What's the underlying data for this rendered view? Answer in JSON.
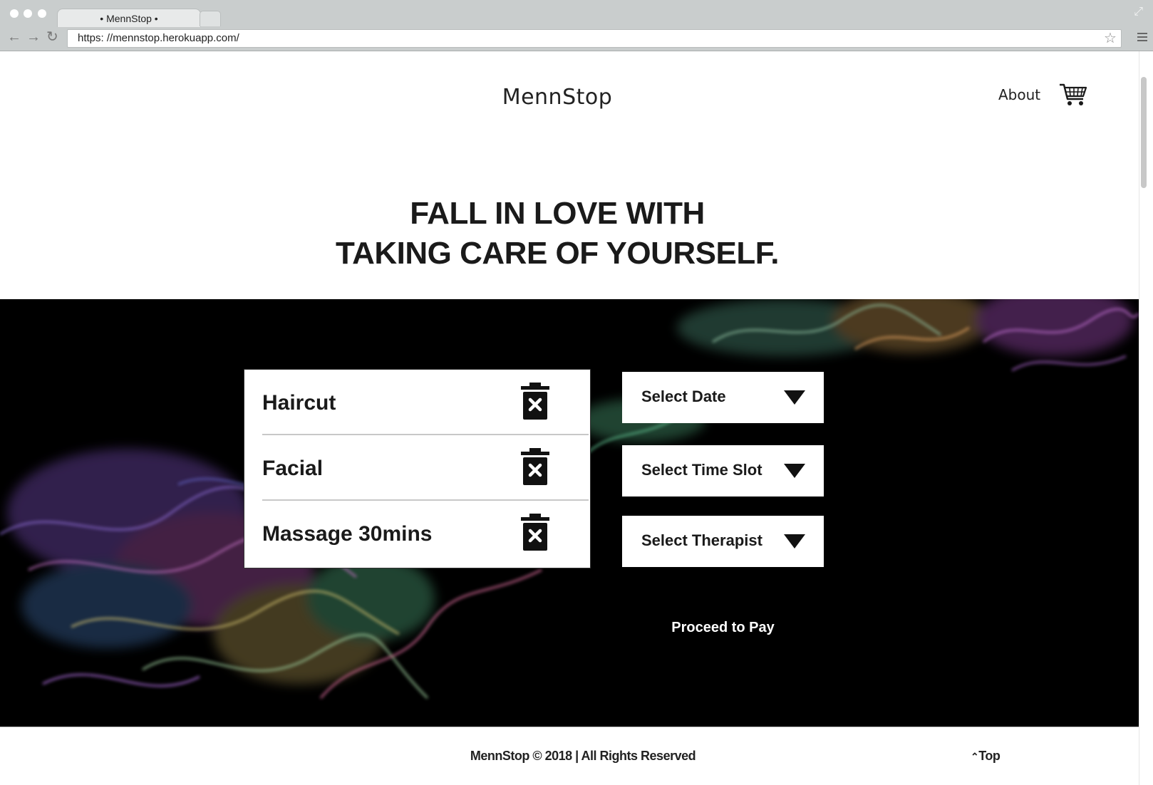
{
  "browser": {
    "tab_title": "• MennStop •",
    "url": "https: //mennstop.herokuapp.com/"
  },
  "header": {
    "brand": "MennStop",
    "about": "About",
    "cart_icon": "cart-icon"
  },
  "hero": {
    "line1": "FALL IN LOVE WITH",
    "line2": "TAKING CARE OF YOURSELF."
  },
  "services": [
    {
      "name": "Haircut"
    },
    {
      "name": "Facial"
    },
    {
      "name": "Massage 30mins"
    }
  ],
  "selects": {
    "date": "Select Date",
    "time": "Select Time Slot",
    "therapist": "Select Therapist"
  },
  "proceed": "Proceed to Pay",
  "footer": {
    "text": "MennStop  © 2018  |  All Rights Reserved",
    "top": "Top"
  },
  "colors": {
    "background": "#000000",
    "panel": "#ffffff",
    "text": "#1a1a1a"
  }
}
